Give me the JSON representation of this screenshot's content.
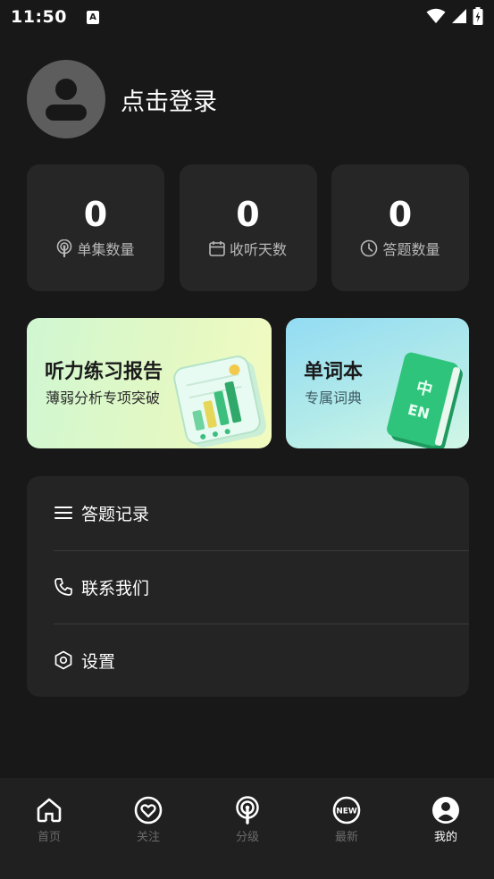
{
  "status_bar": {
    "time": "11:50",
    "notification_letter": "A"
  },
  "profile": {
    "login_text": "点击登录",
    "avatar_icon": "user-avatar-icon"
  },
  "stats": [
    {
      "value": "0",
      "label": "单集数量",
      "icon": "podcast-icon"
    },
    {
      "value": "0",
      "label": "收听天数",
      "icon": "calendar-icon"
    },
    {
      "value": "0",
      "label": "答题数量",
      "icon": "clock-icon"
    }
  ],
  "promos": {
    "report": {
      "title": "听力练习报告",
      "subtitle": "薄弱分析专项突破"
    },
    "vocab": {
      "title": "单词本",
      "subtitle": "专属词典",
      "book_text_top": "中",
      "book_text_bottom": "EN"
    }
  },
  "menu": [
    {
      "label": "答题记录",
      "icon": "list-icon"
    },
    {
      "label": "联系我们",
      "icon": "phone-icon"
    },
    {
      "label": "设置",
      "icon": "hexagon-settings-icon"
    }
  ],
  "nav": {
    "items": [
      {
        "label": "首页",
        "icon": "home-icon"
      },
      {
        "label": "关注",
        "icon": "heart-icon"
      },
      {
        "label": "分级",
        "icon": "podcast-icon"
      },
      {
        "label": "最新",
        "icon": "new-badge-icon",
        "badge_text": "NEW"
      },
      {
        "label": "我的",
        "icon": "user-icon"
      }
    ],
    "active_index": 4
  },
  "colors": {
    "background": "#181818",
    "card": "#262626",
    "nav_inactive": "#6b6b6b",
    "nav_active": "#ffffff"
  }
}
